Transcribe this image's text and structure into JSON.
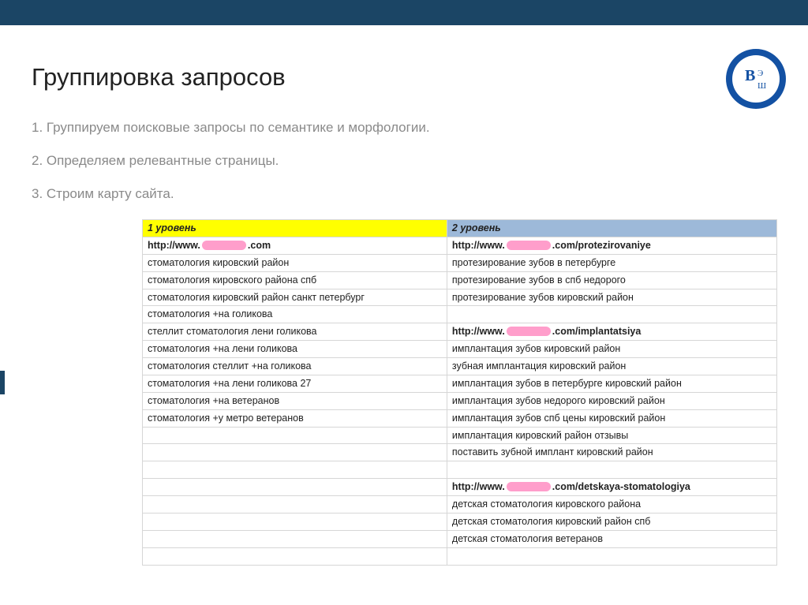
{
  "title": "Группировка запросов",
  "steps": [
    "1. Группируем поисковые запросы по семантике и морфологии.",
    "2. Определяем релевантные страницы.",
    "3. Строим карту сайта."
  ],
  "headers": {
    "left": "1 уровень",
    "right": "2 уровень"
  },
  "url_parts": {
    "pre": "http://www.",
    "post_base": ".com",
    "post_protez": ".com/protezirovaniye",
    "post_implant": ".com/implantatsiya",
    "post_det": ".com/detskaya-stomatologiya"
  },
  "rows": [
    {
      "l_url": "base",
      "r_url": "protez"
    },
    {
      "l": "стоматология кировский район",
      "r": "протезирование зубов в петербурге"
    },
    {
      "l": "стоматология кировского района спб",
      "r": "протезирование зубов в спб недорого"
    },
    {
      "l": "стоматология кировский район санкт петербург",
      "r": "протезирование зубов кировский район"
    },
    {
      "l": "стоматология +на голикова",
      "r": ""
    },
    {
      "l": "стеллит стоматология лени голикова",
      "r_url": "implant"
    },
    {
      "l": "стоматология +на лени голикова",
      "r": "имплантация зубов кировский район"
    },
    {
      "l": "стоматология стеллит +на голикова",
      "r": "зубная имплантация кировский район"
    },
    {
      "l": "стоматология +на лени голикова 27",
      "r": "имплантация зубов в петербурге кировский район"
    },
    {
      "l": "стоматология +на ветеранов",
      "r": "имплантация зубов недорого кировский район"
    },
    {
      "l": "стоматология +у метро ветеранов",
      "r": "имплантация зубов спб цены кировский район"
    },
    {
      "l": "",
      "r": "имплантация кировский район отзывы"
    },
    {
      "l": "",
      "r": "поставить зубной имплант кировский район"
    },
    {
      "l": "",
      "r": ""
    },
    {
      "l": "",
      "r_url": "det"
    },
    {
      "l": "",
      "r": "детская стоматология кировского района"
    },
    {
      "l": "",
      "r": "детская стоматология кировский район спб"
    },
    {
      "l": "",
      "r": "детская стоматология ветеранов"
    },
    {
      "l": "",
      "r": ""
    }
  ]
}
